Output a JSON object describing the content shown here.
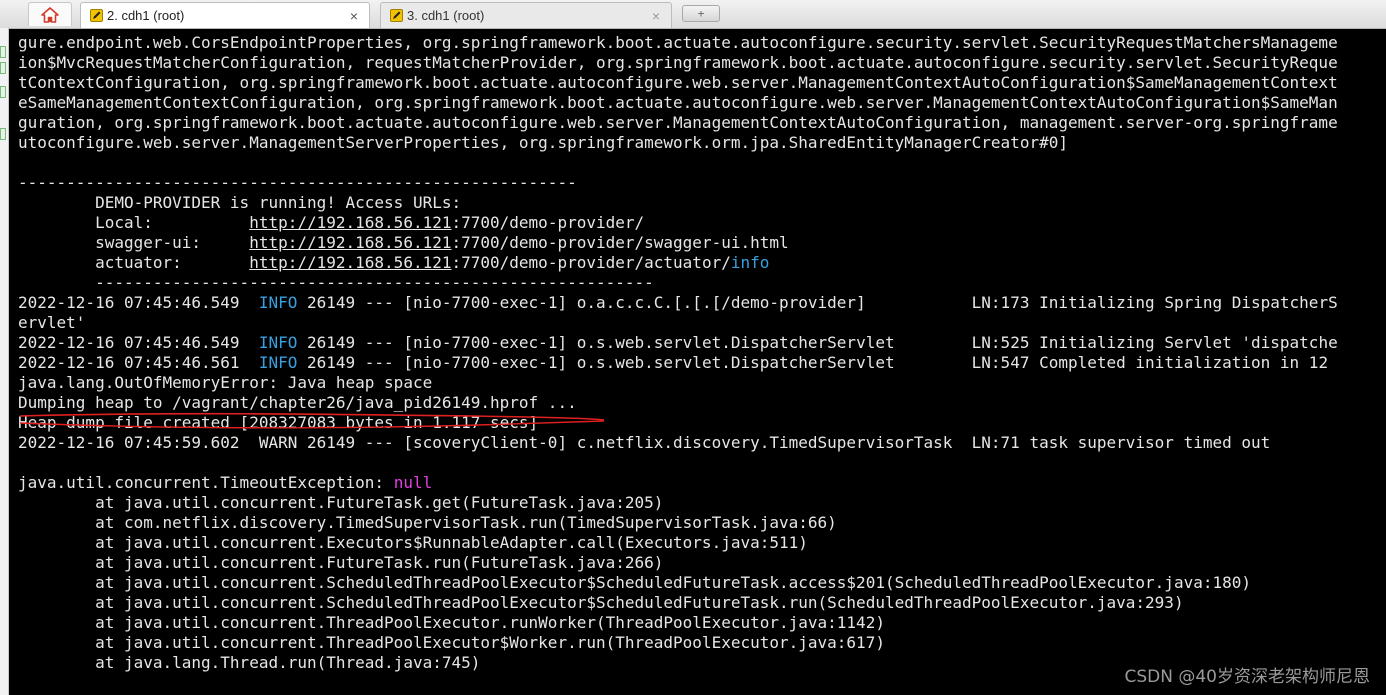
{
  "tabs": {
    "home_icon": "home-icon",
    "active": {
      "label": "2. cdh1 (root)",
      "close": "×",
      "icon": "pencil-icon"
    },
    "inactive": {
      "label": "3. cdh1 (root)",
      "close": "×",
      "icon": "pencil-icon"
    },
    "new_tab_icon": "+"
  },
  "terminal": {
    "wrap": [
      "gure.endpoint.web.CorsEndpointProperties, org.springframework.boot.actuate.autoconfigure.security.servlet.SecurityRequestMatchersManageme",
      "ion$MvcRequestMatcherConfiguration, requestMatcherProvider, org.springframework.boot.actuate.autoconfigure.security.servlet.SecurityReque",
      "tContextConfiguration, org.springframework.boot.actuate.autoconfigure.web.server.ManagementContextAutoConfiguration$SameManagementContext",
      "eSameManagementContextConfiguration, org.springframework.boot.actuate.autoconfigure.web.server.ManagementContextAutoConfiguration$SameMan",
      "guration, org.springframework.boot.actuate.autoconfigure.web.server.ManagementContextAutoConfiguration, management.server-org.springframe",
      "utoconfigure.web.server.ManagementServerProperties, org.springframework.orm.jpa.SharedEntityManagerCreator#0]"
    ],
    "divider1": "----------------------------------------------------------",
    "banner": {
      "running": "        DEMO-PROVIDER is running! Access URLs:",
      "local_label": "        Local:          ",
      "local_host": "http://192.168.56.121",
      "local_path": ":7700/demo-provider/",
      "swagger_label": "        swagger-ui:     ",
      "swagger_host": "http://192.168.56.121",
      "swagger_path": ":7700/demo-provider/swagger-ui.html",
      "actuator_label": "        actuator:       ",
      "actuator_host": "http://192.168.56.121",
      "actuator_path": ":7700/demo-provider/actuator/",
      "actuator_info": "info"
    },
    "divider2": "        ----------------------------------------------------------",
    "log1": {
      "ts": "2022-12-16 07:45:46.549  ",
      "level": "INFO",
      "rest": " 26149 --- [nio-7700-exec-1] o.a.c.c.C.[.[.[/demo-provider]           LN:173 Initializing Spring DispatcherS"
    },
    "log1_wrap": "ervlet'",
    "log2": {
      "ts": "2022-12-16 07:45:46.549  ",
      "level": "INFO",
      "rest": " 26149 --- [nio-7700-exec-1] o.s.web.servlet.DispatcherServlet        LN:525 Initializing Servlet 'dispatche"
    },
    "log3": {
      "ts": "2022-12-16 07:45:46.561  ",
      "level": "INFO",
      "rest": " 26149 --- [nio-7700-exec-1] o.s.web.servlet.DispatcherServlet        LN:547 Completed initialization in 12 "
    },
    "oom": "java.lang.OutOfMemoryError: Java heap space",
    "dumping": "Dumping heap to /vagrant/chapter26/java_pid26149.hprof ...",
    "heap_created": "Heap dump file created [208327083 bytes in 1.117 secs]",
    "warn": "2022-12-16 07:45:59.602  WARN 26149 --- [scoveryClient-0] c.netflix.discovery.TimedSupervisorTask  LN:71 task supervisor timed out",
    "blank": " ",
    "exc_prefix": "java.util.concurrent.TimeoutException: ",
    "exc_null": "null",
    "stack": [
      "        at java.util.concurrent.FutureTask.get(FutureTask.java:205)",
      "        at com.netflix.discovery.TimedSupervisorTask.run(TimedSupervisorTask.java:66)",
      "        at java.util.concurrent.Executors$RunnableAdapter.call(Executors.java:511)",
      "        at java.util.concurrent.FutureTask.run(FutureTask.java:266)",
      "        at java.util.concurrent.ScheduledThreadPoolExecutor$ScheduledFutureTask.access$201(ScheduledThreadPoolExecutor.java:180)",
      "        at java.util.concurrent.ScheduledThreadPoolExecutor$ScheduledFutureTask.run(ScheduledThreadPoolExecutor.java:293)",
      "        at java.util.concurrent.ThreadPoolExecutor.runWorker(ThreadPoolExecutor.java:1142)",
      "        at java.util.concurrent.ThreadPoolExecutor$Worker.run(ThreadPoolExecutor.java:617)",
      "        at java.lang.Thread.run(Thread.java:745)"
    ]
  },
  "watermark": "CSDN @40岁资深老架构师尼恩",
  "colors": {
    "background": "#000000",
    "text": "#e6e6e6",
    "info": "#38a0e0",
    "null_keyword": "#e040e0",
    "underline_annotation": "#e02020"
  }
}
